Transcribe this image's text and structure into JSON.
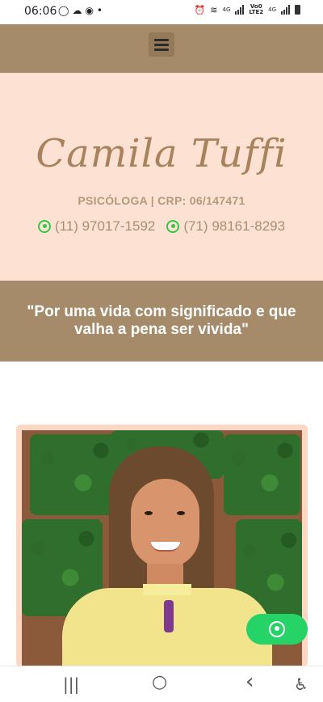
{
  "status_bar": {
    "time": "06:06",
    "left_icons": [
      "whatsapp-icon",
      "weather-icon",
      "chrome-icon",
      "dot-icon"
    ],
    "right_icons": [
      "alarm-icon",
      "wifi-icon",
      "signal-icon",
      "volte-icon",
      "signal-icon",
      "battery-icon"
    ],
    "net_label_1": "4G",
    "net_label_2": "4G",
    "volte_label_top": "Vo0",
    "volte_label_bottom": "LTE2"
  },
  "navbar": {
    "menu_icon": "hamburger-menu-icon",
    "background": "#a68b6a"
  },
  "hero": {
    "name": "Camila Tuffi",
    "role": "PSICÓLOGA | CRP: 06/147471",
    "phones": [
      {
        "icon": "whatsapp-icon",
        "number": "(11) 97017-1592"
      },
      {
        "icon": "whatsapp-icon",
        "number": "(71) 98161-8293"
      }
    ],
    "background": "#fde2d3",
    "name_color": "#a8825c"
  },
  "quote": {
    "text": "\"Por uma vida com significado e que valha a pena ser vivida\"",
    "background": "#a68b6a"
  },
  "photo": {
    "frame_color": "#fbd7c4"
  },
  "floating_button": {
    "icon": "whatsapp-icon",
    "color": "#25d366"
  },
  "system_nav": {
    "recents": "|||",
    "home": "○",
    "back": "‹",
    "accessibility": "accessibility-icon"
  }
}
